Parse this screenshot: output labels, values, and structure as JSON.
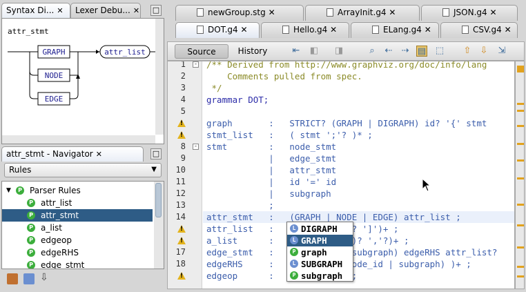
{
  "syntax_panel": {
    "tabs": [
      {
        "label": "Syntax Di...",
        "close": "✕"
      },
      {
        "label": "Lexer Debu...",
        "close": "✕"
      }
    ],
    "window_button": "□",
    "rule_name": "attr_stmt",
    "diagram": {
      "nodes": [
        "GRAPH",
        "NODE",
        "EDGE",
        "attr_list"
      ]
    }
  },
  "navigator": {
    "title": "attr_stmt - Navigator",
    "close": "✕",
    "window_button": "□",
    "filter_value": "Rules",
    "root_label": "Parser Rules",
    "root_icon": "P",
    "items": [
      {
        "label": "attr_list",
        "icon": "P"
      },
      {
        "label": "attr_stmt",
        "icon": "P",
        "selected": true
      },
      {
        "label": "a_list",
        "icon": "P"
      },
      {
        "label": "edgeop",
        "icon": "P"
      },
      {
        "label": "edgeRHS",
        "icon": "P"
      },
      {
        "label": "edge_stmt",
        "icon": "P"
      }
    ],
    "bottom_icons": [
      "sort-by-category-icon",
      "sort-alpha-icon",
      "sort-order-icon"
    ]
  },
  "editor": {
    "tabs_row1": [
      {
        "label": "newGroup.stg",
        "close": "✕"
      },
      {
        "label": "ArrayInit.g4",
        "close": "✕"
      },
      {
        "label": "JSON.g4",
        "close": "✕"
      }
    ],
    "tabs_row2": [
      {
        "label": "DOT.g4",
        "close": "✕",
        "active": true
      },
      {
        "label": "Hello.g4",
        "close": "✕"
      },
      {
        "label": "ELang.g4",
        "close": "✕"
      },
      {
        "label": "CSV.g4",
        "close": "✕"
      }
    ],
    "toolbar": {
      "source_label": "Source",
      "history_label": "History"
    },
    "lines": [
      {
        "n": "1",
        "text": "/** Derived from http://www.graphviz.org/doc/info/lang",
        "cls": "kw-comment",
        "fold": "-"
      },
      {
        "n": "2",
        "text": "    Comments pulled from spec.",
        "cls": "kw-comment"
      },
      {
        "n": "3",
        "text": " */",
        "cls": "kw-comment"
      },
      {
        "n": "4",
        "text": "grammar DOT;",
        "cls": "kw-tok"
      },
      {
        "n": "5",
        "text": "",
        "cls": ""
      },
      {
        "n": "",
        "text": "graph       :   STRICT? (GRAPH | DIGRAPH) id? '{' stmt",
        "cls": "kw-rule",
        "warn": true
      },
      {
        "n": "",
        "text": "stmt_list   :   ( stmt ';'? )* ;",
        "cls": "kw-rule",
        "warn": true
      },
      {
        "n": "8",
        "text": "stmt        :   node_stmt",
        "cls": "kw-rule",
        "fold": "-"
      },
      {
        "n": "9",
        "text": "            |   edge_stmt",
        "cls": "kw-rule"
      },
      {
        "n": "10",
        "text": "            |   attr_stmt",
        "cls": "kw-rule"
      },
      {
        "n": "11",
        "text": "            |   id '=' id",
        "cls": "kw-rule"
      },
      {
        "n": "12",
        "text": "            |   subgraph",
        "cls": "kw-rule"
      },
      {
        "n": "13",
        "text": "            ;",
        "cls": "kw-rule"
      },
      {
        "n": "14",
        "text": "attr_stmt   :   (GRAPH | NODE | EDGE) attr_list ;",
        "cls": "kw-rule",
        "highlight": true
      },
      {
        "n": "",
        "text": "attr_list   :               ? ']')+ ;",
        "cls": "kw-rule",
        "warn": true
      },
      {
        "n": "",
        "text": "a_list      :               )? ','?)+ ;",
        "cls": "kw-rule",
        "warn": true
      },
      {
        "n": "17",
        "text": "edge_stmt   :               subgraph) edgeRHS attr_list?",
        "cls": "kw-rule"
      },
      {
        "n": "18",
        "text": "edgeRHS     :               ode_id | subgraph) )+ ;",
        "cls": "kw-rule"
      },
      {
        "n": "",
        "text": "edgeop      :               ;",
        "cls": "kw-rule",
        "warn": true
      }
    ],
    "completion": [
      {
        "label": "DIGRAPH",
        "icon": "L"
      },
      {
        "label": "GRAPH",
        "icon": "L",
        "selected": true
      },
      {
        "label": "graph",
        "icon": "P"
      },
      {
        "label": "SUBGRAPH",
        "icon": "L"
      },
      {
        "label": "subgraph",
        "icon": "P"
      }
    ]
  },
  "colors": {
    "selection": "#2e5c86",
    "comment": "#8b8b28",
    "rule": "#3b5dab",
    "warning": "#e3b31c",
    "parser_icon": "#3cae3c",
    "lexer_icon": "#6b8fd0"
  }
}
